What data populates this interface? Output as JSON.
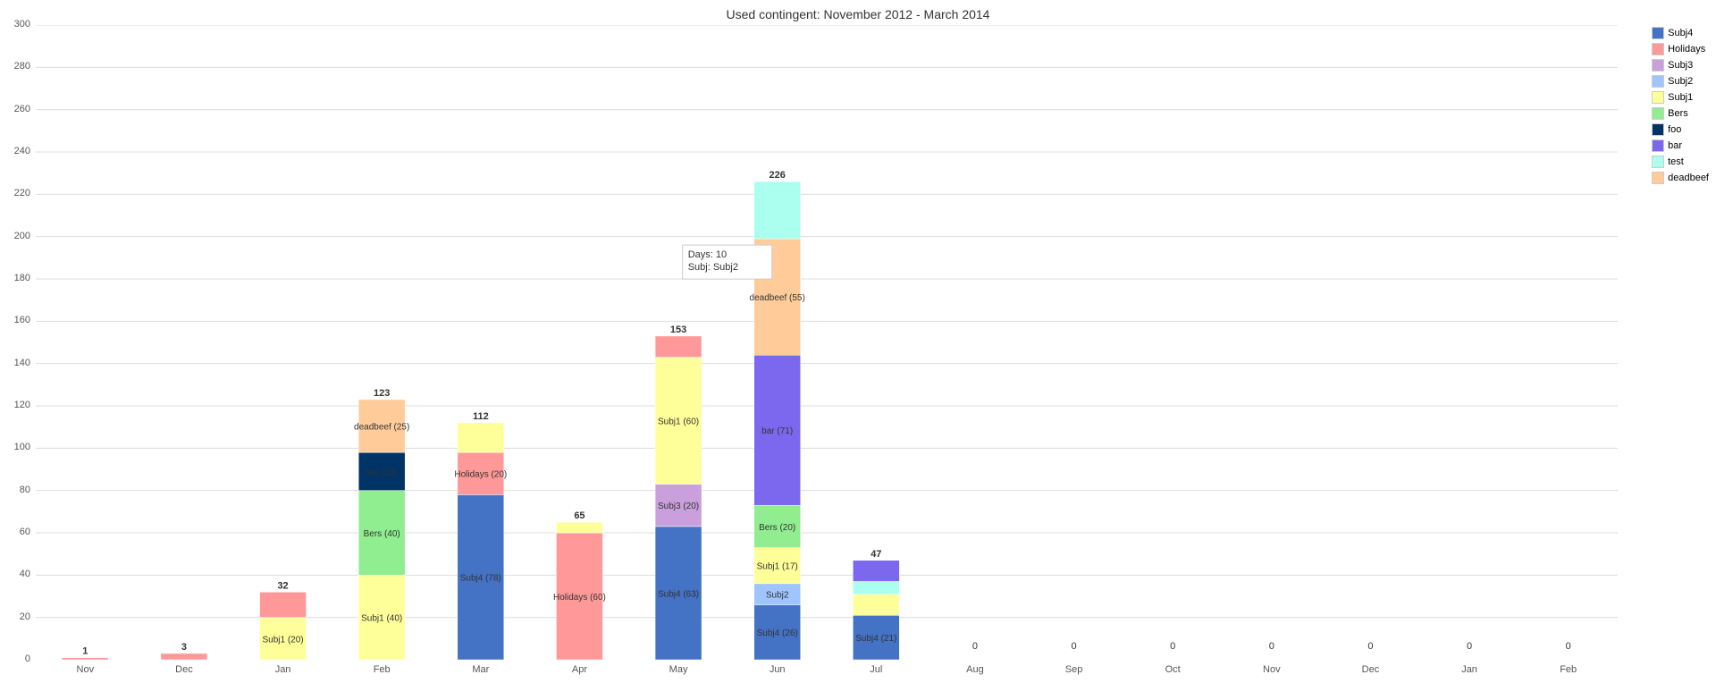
{
  "title": "Used contingent: November 2012 - March 2014",
  "colors": {
    "Subj4": "#4472C4",
    "Holidays": "#FF9999",
    "Subj3": "#C9A0DC",
    "Subj2": "#A0C4FF",
    "Subj1": "#FFFF99",
    "Bers": "#90EE90",
    "foo": "#003366",
    "bar": "#7B68EE",
    "test": "#AAFFEE",
    "deadbeef": "#FFCC99"
  },
  "legend": [
    {
      "label": "Subj4",
      "color": "#4472C4"
    },
    {
      "label": "Holidays",
      "color": "#FF9999"
    },
    {
      "label": "Subj3",
      "color": "#C9A0DC"
    },
    {
      "label": "Subj2",
      "color": "#A0C4FF"
    },
    {
      "label": "Subj1",
      "color": "#FFFF99"
    },
    {
      "label": "Bers",
      "color": "#90EE90"
    },
    {
      "label": "foo",
      "color": "#003366"
    },
    {
      "label": "bar",
      "color": "#7B68EE"
    },
    {
      "label": "test",
      "color": "#AAFFEE"
    },
    {
      "label": "deadbeef",
      "color": "#FFCC99"
    }
  ],
  "yAxis": {
    "max": 300,
    "ticks": [
      0,
      20,
      40,
      60,
      80,
      100,
      120,
      140,
      160,
      180,
      200,
      220,
      240,
      260,
      280,
      300
    ]
  },
  "xLabels": [
    "Nov",
    "Dec",
    "Jan",
    "Feb",
    "Mar",
    "Apr",
    "May",
    "Jun",
    "Jul",
    "Aug",
    "Sep",
    "Oct",
    "Nov",
    "Dec",
    "Jan",
    "Feb"
  ],
  "bars": [
    {
      "month": "Nov",
      "total": 1,
      "segments": [
        {
          "label": "",
          "value": 1,
          "color": "#FF9999"
        }
      ]
    },
    {
      "month": "Dec",
      "total": 3,
      "segments": [
        {
          "label": "",
          "value": 3,
          "color": "#FF9999"
        }
      ]
    },
    {
      "month": "Jan",
      "total": 32,
      "segments": [
        {
          "label": "Subj1 (20)",
          "value": 20,
          "color": "#FFFF99"
        },
        {
          "label": "",
          "value": 12,
          "color": "#FF9999"
        }
      ]
    },
    {
      "month": "Feb",
      "total": 123,
      "segments": [
        {
          "label": "Subj1 (40)",
          "value": 40,
          "color": "#FFFF99"
        },
        {
          "label": "Bers (40)",
          "value": 40,
          "color": "#90EE90"
        },
        {
          "label": "foo (18)",
          "value": 18,
          "color": "#003366"
        },
        {
          "label": "deadbeef (25)",
          "value": 25,
          "color": "#FFCC99"
        }
      ]
    },
    {
      "month": "Mar",
      "total": 112,
      "segments": [
        {
          "label": "Subj4 (78)",
          "value": 78,
          "color": "#4472C4"
        },
        {
          "label": "Holidays (20)",
          "value": 20,
          "color": "#FF9999"
        },
        {
          "label": "",
          "value": 14,
          "color": "#FFFF99"
        }
      ]
    },
    {
      "month": "Apr",
      "total": 65,
      "segments": [
        {
          "label": "Holidays (60)",
          "value": 60,
          "color": "#FF9999"
        },
        {
          "label": "",
          "value": 5,
          "color": "#FFFF99"
        }
      ]
    },
    {
      "month": "May",
      "total": 153,
      "segments": [
        {
          "label": "Subj4 (63)",
          "value": 63,
          "color": "#4472C4"
        },
        {
          "label": "Subj3 (20)",
          "value": 20,
          "color": "#C9A0DC"
        },
        {
          "label": "Subj1 (60)",
          "value": 60,
          "color": "#FFFF99"
        },
        {
          "label": "",
          "value": 10,
          "color": "#FF9999"
        }
      ]
    },
    {
      "month": "Jun",
      "total": 226,
      "segments": [
        {
          "label": "Subj4 (26)",
          "value": 26,
          "color": "#4472C4"
        },
        {
          "label": "Subj2",
          "value": 10,
          "color": "#A0C4FF"
        },
        {
          "label": "Subj1 (17)",
          "value": 17,
          "color": "#FFFF99"
        },
        {
          "label": "Bers (20)",
          "value": 20,
          "color": "#90EE90"
        },
        {
          "label": "bar (71)",
          "value": 71,
          "color": "#7B68EE"
        },
        {
          "label": "deadbeef (55)",
          "value": 55,
          "color": "#FFCC99"
        },
        {
          "label": "",
          "value": 27,
          "color": "#AAFFEE"
        }
      ]
    },
    {
      "month": "Jul",
      "total": 47,
      "segments": [
        {
          "label": "Subj4 (21)",
          "value": 21,
          "color": "#4472C4"
        },
        {
          "label": "",
          "value": 10,
          "color": "#FFFF99"
        },
        {
          "label": "",
          "value": 6,
          "color": "#AAFFEE"
        },
        {
          "label": "",
          "value": 10,
          "color": "#7B68EE"
        }
      ]
    },
    {
      "month": "Aug",
      "total": 0,
      "segments": []
    },
    {
      "month": "Sep",
      "total": 0,
      "segments": []
    },
    {
      "month": "Oct",
      "total": 0,
      "segments": []
    },
    {
      "month": "Nov",
      "total": 0,
      "segments": []
    },
    {
      "month": "Dec",
      "total": 0,
      "segments": []
    },
    {
      "month": "Jan",
      "total": 0,
      "segments": []
    },
    {
      "month": "Feb",
      "total": 0,
      "segments": []
    }
  ],
  "tooltip": {
    "days_label": "Days:",
    "days_value": "10",
    "subj_label": "Subj:",
    "subj_value": "Subj2"
  }
}
